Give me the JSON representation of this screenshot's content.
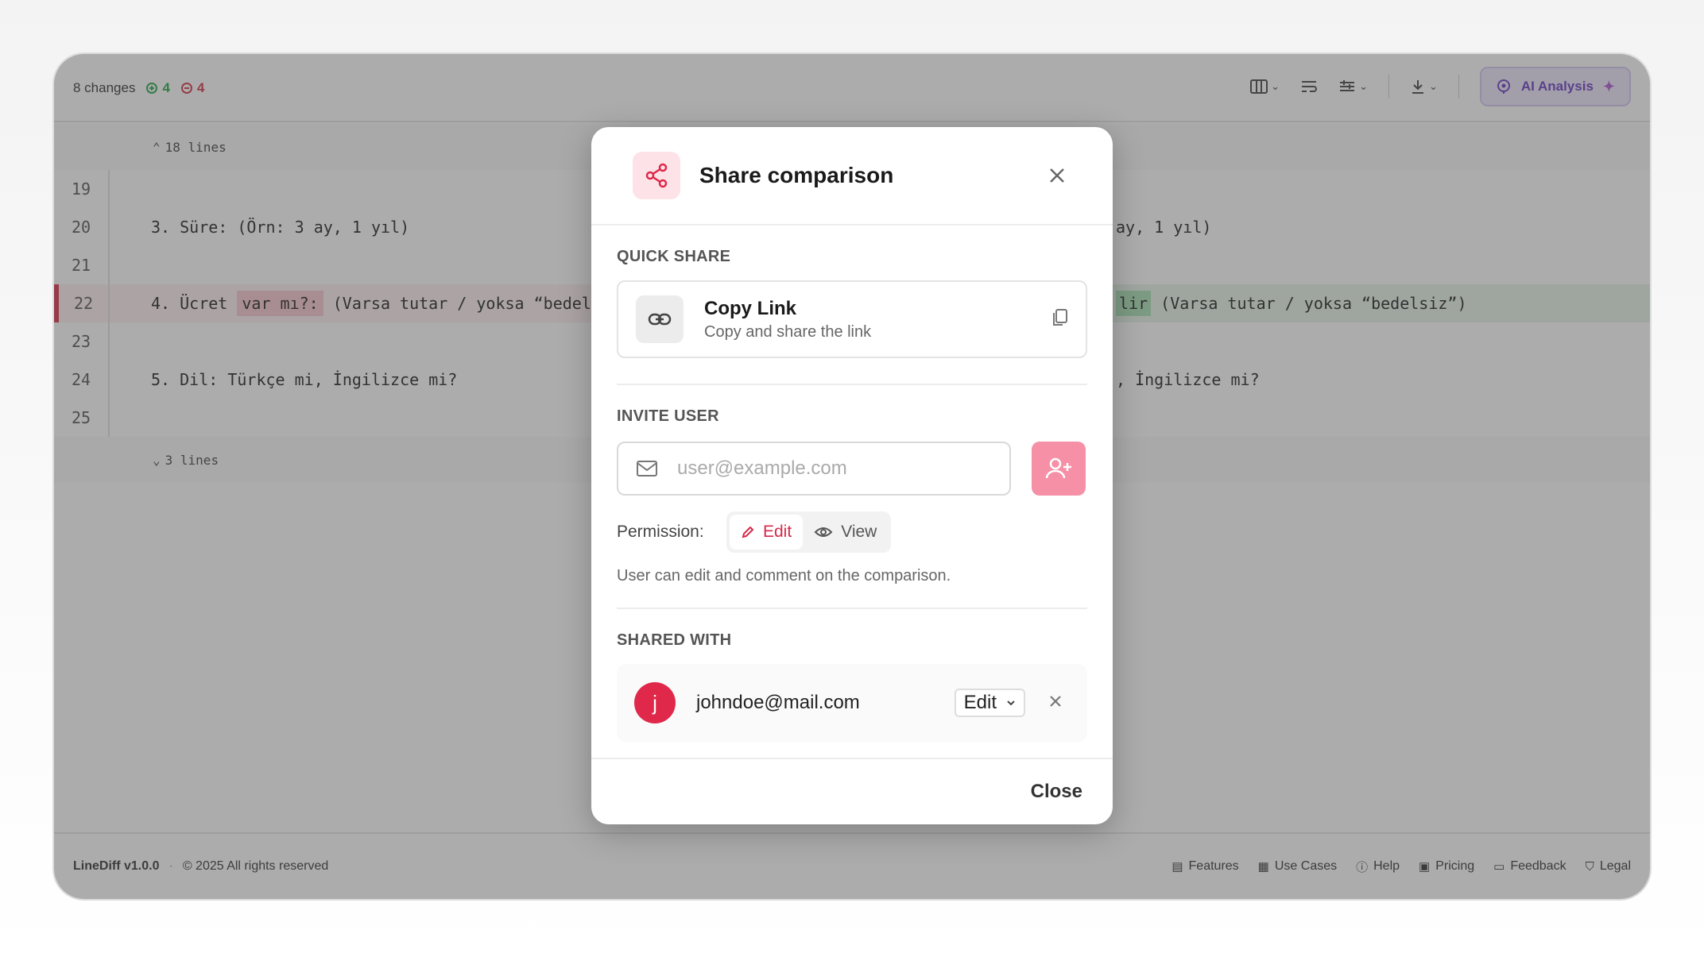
{
  "toolbar": {
    "changes_label": "8 changes",
    "additions": "4",
    "removals": "4",
    "ai_button": "AI Analysis"
  },
  "diff": {
    "fold_top": "18 lines",
    "fold_bottom": "3 lines",
    "lines": [
      {
        "num": "19",
        "left": "",
        "right": ""
      },
      {
        "num": "20",
        "left": "3. Süre: (Örn: 3 ay, 1 yıl)",
        "right": "ay, 1 yıl)"
      },
      {
        "num": "21",
        "left": "",
        "right": ""
      },
      {
        "num": "22",
        "left_prefix": "4. Ücret ",
        "left_removed": "var mı?:",
        "left_suffix": " (Varsa tutar / yoksa “bedels",
        "right_added": "lir",
        "right_suffix": " (Varsa tutar / yoksa “bedelsiz”)"
      },
      {
        "num": "23",
        "left": "",
        "right": ""
      },
      {
        "num": "24",
        "left": "5. Dil: Türkçe mi, İngilizce mi?",
        "right": ", İngilizce mi?"
      },
      {
        "num": "25",
        "left": "",
        "right": ""
      }
    ]
  },
  "footer": {
    "version": "LineDiff v1.0.0",
    "copyright": "© 2025 All rights reserved",
    "links": [
      "Features",
      "Use Cases",
      "Help",
      "Pricing",
      "Feedback",
      "Legal"
    ]
  },
  "modal": {
    "title": "Share comparison",
    "quick_share_title": "QUICK SHARE",
    "copy_link_title": "Copy Link",
    "copy_link_sub": "Copy and share the link",
    "invite_title": "INVITE USER",
    "email_placeholder": "user@example.com",
    "permission_label": "Permission:",
    "perm_edit": "Edit",
    "perm_view": "View",
    "perm_desc": "User can edit and comment on the comparison.",
    "shared_title": "SHARED WITH",
    "shared_user": {
      "initial": "j",
      "email": "johndoe@mail.com",
      "role": "Edit"
    },
    "close_label": "Close"
  },
  "colors": {
    "accent": "#e0284a",
    "ai": "#6a3bc4",
    "added": "#27a84a",
    "removed": "#d83349"
  }
}
